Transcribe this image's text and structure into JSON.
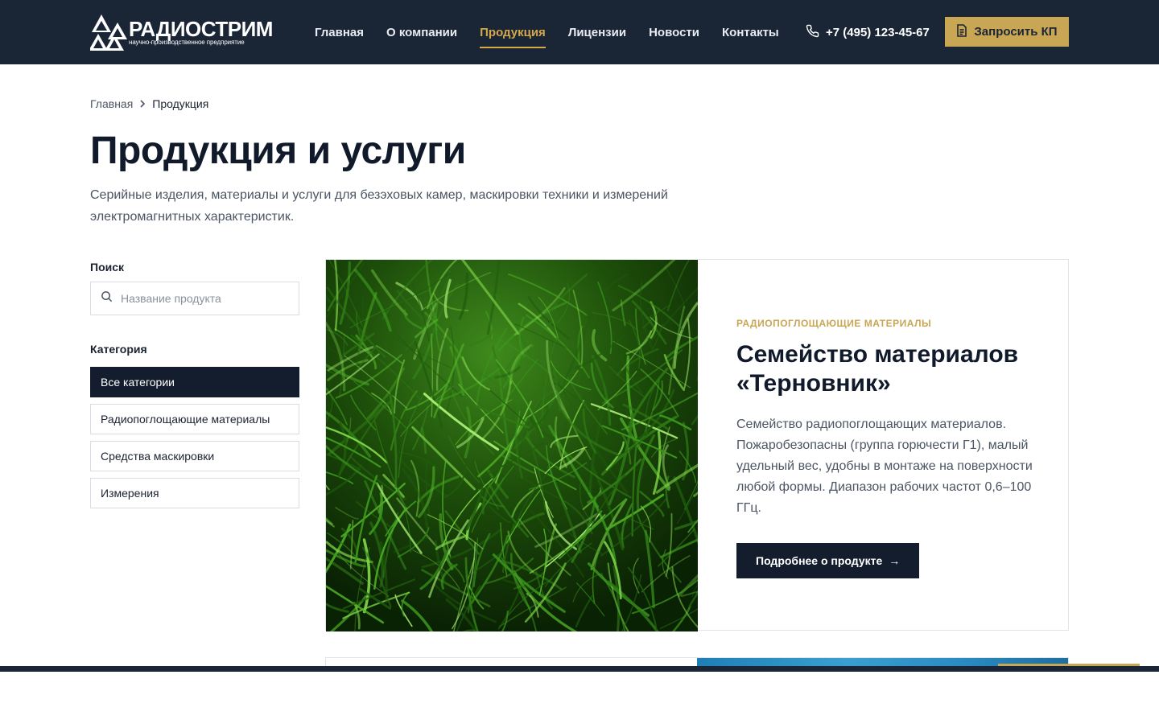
{
  "header": {
    "logo_name": "РАДИОСТРИМ",
    "logo_sub": "научно-производственное предприятие",
    "nav": [
      {
        "label": "Главная",
        "active": false
      },
      {
        "label": "О компании",
        "active": false
      },
      {
        "label": "Продукция",
        "active": true
      },
      {
        "label": "Лицензии",
        "active": false
      },
      {
        "label": "Новости",
        "active": false
      },
      {
        "label": "Контакты",
        "active": false
      }
    ],
    "phone": "+7 (495) 123-45-67",
    "phone_icon": "phone-icon",
    "cta_label": "Запросить КП",
    "cta_icon": "document-icon"
  },
  "breadcrumb": {
    "home": "Главная",
    "separator": "›",
    "current": "Продукция"
  },
  "page": {
    "title": "Продукция и услуги",
    "subtitle": "Серийные изделия, материалы и услуги для безэховых камер, маскировки техники и измерений электромагнитных характеристик."
  },
  "sidebar": {
    "search_label": "Поиск",
    "search_placeholder": "Название продукта",
    "search_value": "",
    "category_label": "Категория",
    "categories": [
      {
        "label": "Все категории",
        "active": true
      },
      {
        "label": "Радиопоглощающие материалы",
        "active": false
      },
      {
        "label": "Средства маскировки",
        "active": false
      },
      {
        "label": "Измерения",
        "active": false
      }
    ]
  },
  "product": {
    "category": "Радиопоглощающие материалы",
    "title": "Семейство материалов «Терновник»",
    "description": "Семейство радиопоглощающих материалов. Пожаробезопасны (группа горючести Г1), малый удельный вес, удобны в монтаже на поверхности любой формы. Диапазон рабочих частот 0,6–100 ГГц.",
    "button_label": "Подробнее о продукте",
    "button_arrow": "→",
    "image": "green-fiber-material-photo"
  },
  "colors": {
    "header_bg": "#1a2536",
    "accent_gold": "#c9a653",
    "dark_button": "#141d2d"
  }
}
